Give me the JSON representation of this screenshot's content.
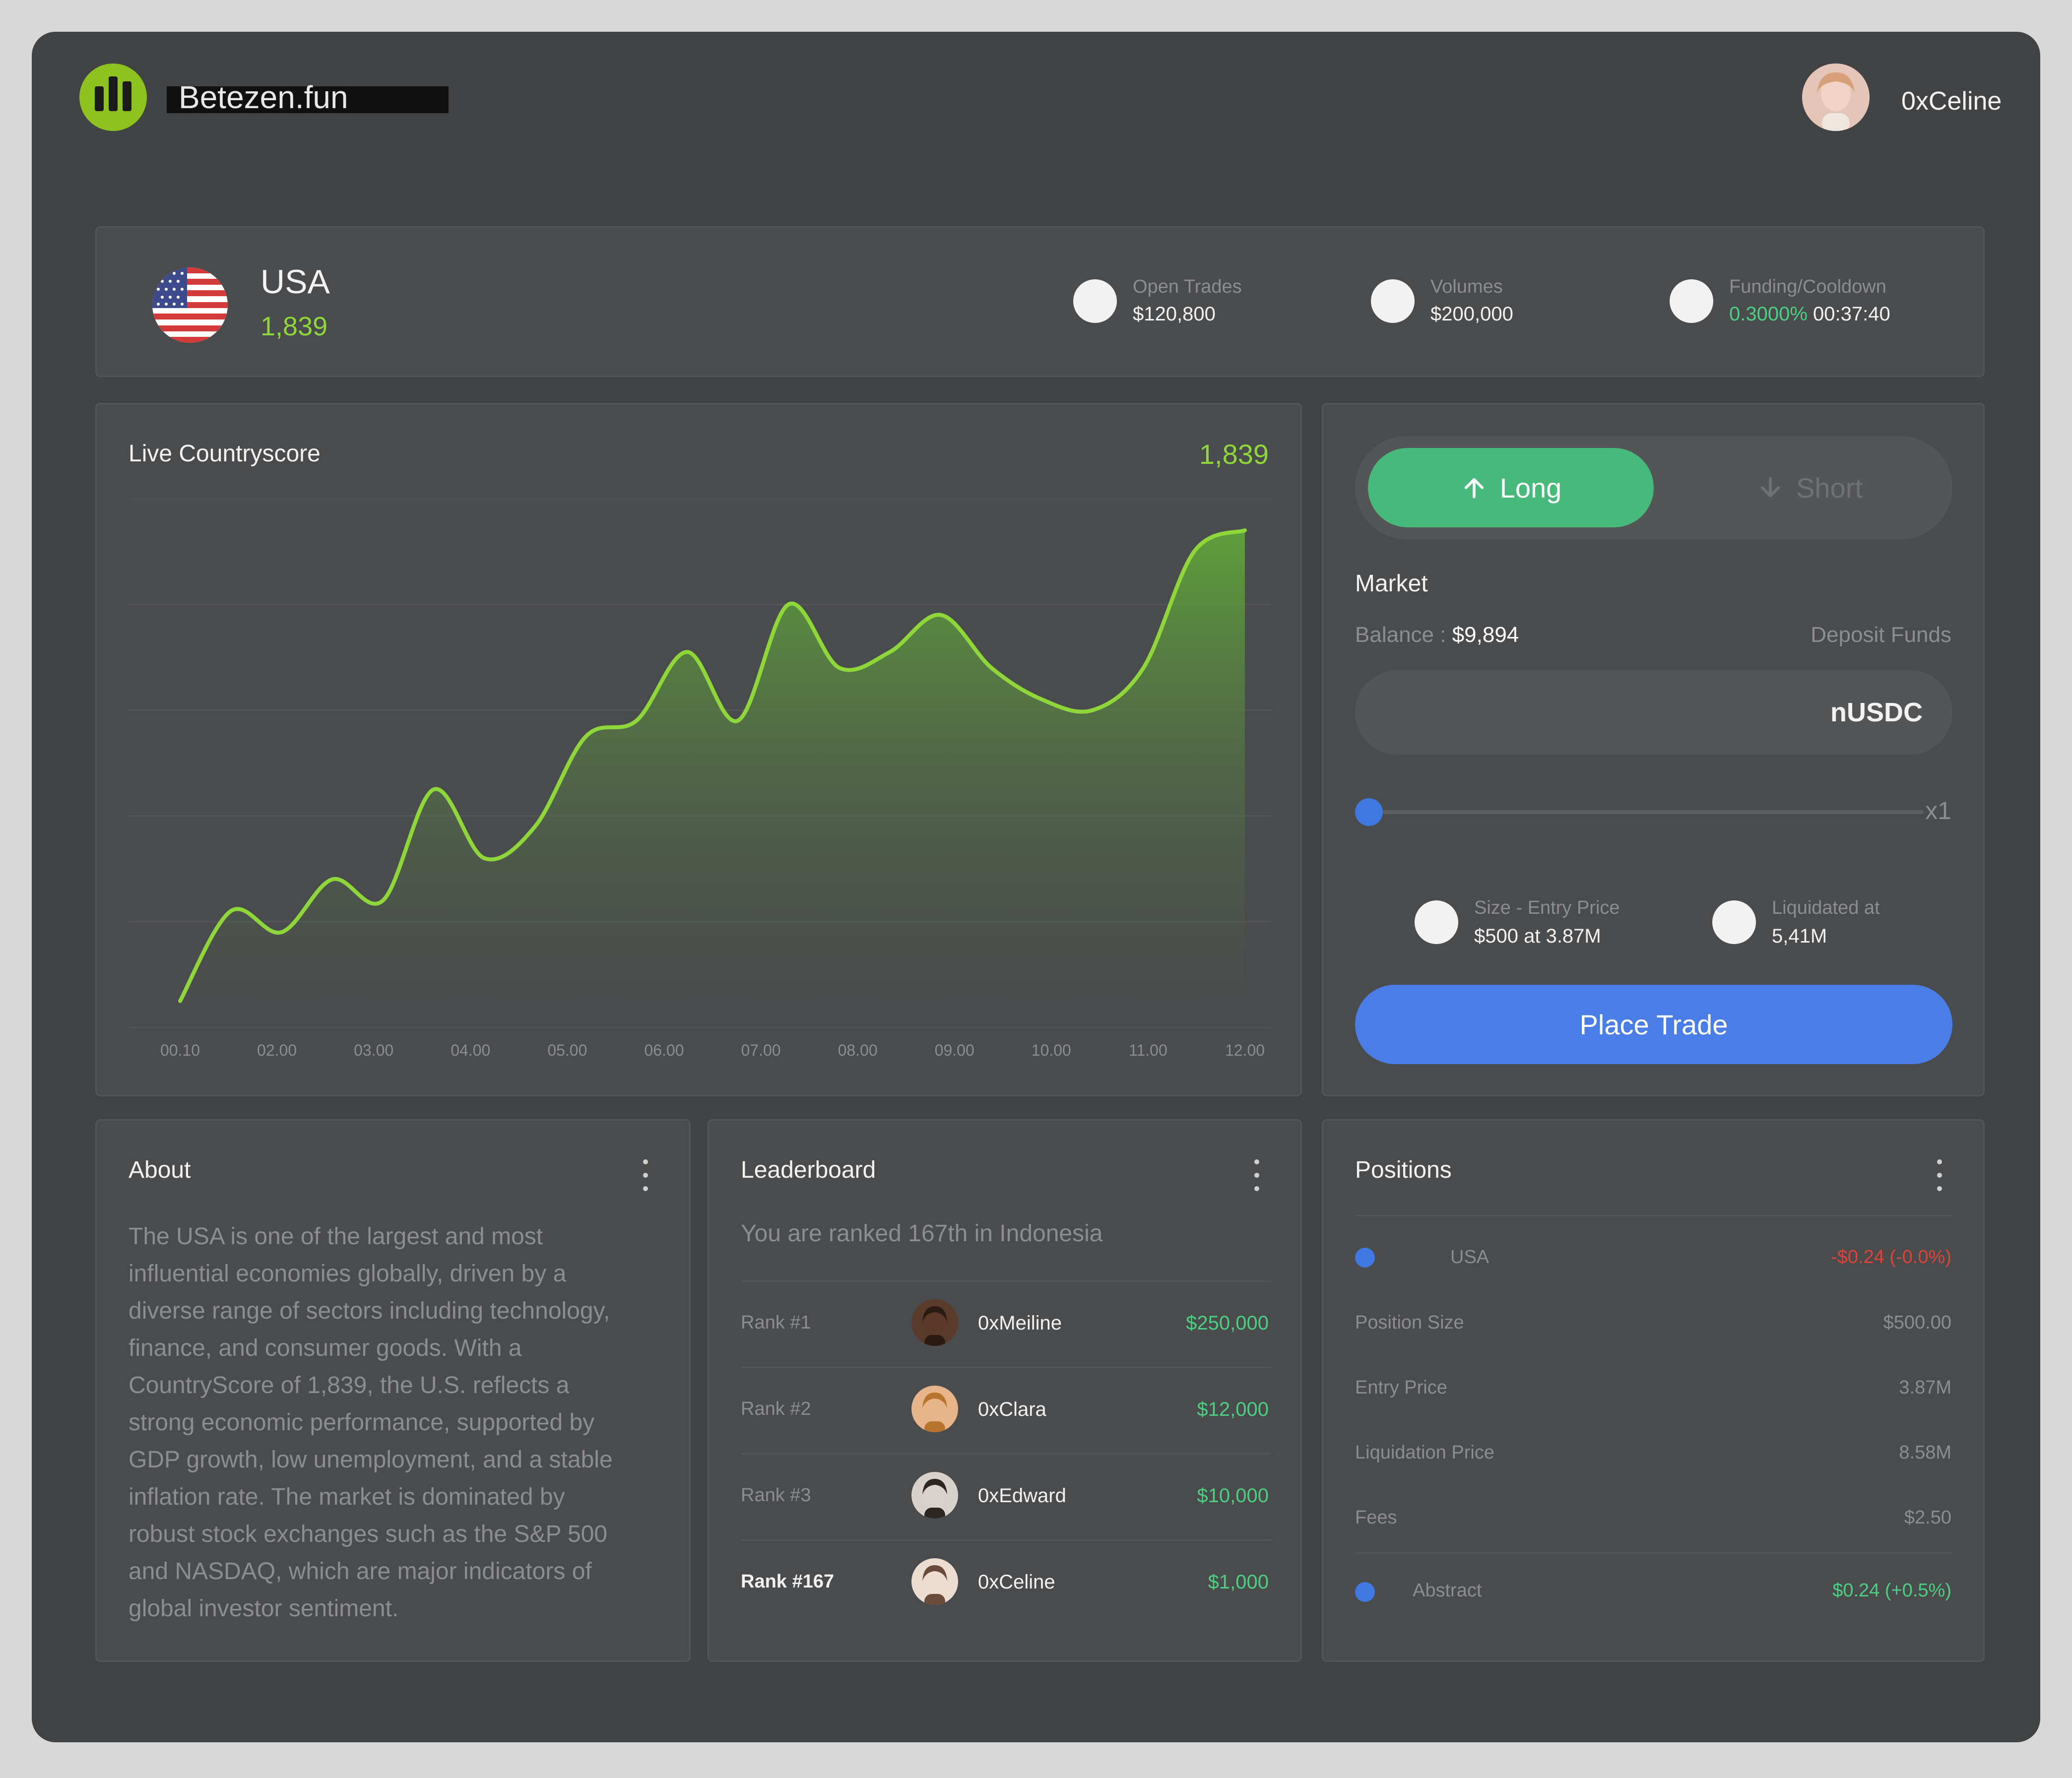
{
  "header": {
    "brand": "Betezen.fun",
    "username": "0xCeline"
  },
  "country": {
    "name": "USA",
    "score": "1,839",
    "stats": [
      {
        "label": "Open Trades",
        "value": "$120,800"
      },
      {
        "label": "Volumes",
        "value": "$200,000"
      },
      {
        "label": "Funding/Cooldown",
        "value_rate": "0.3000%",
        "value_time": "00:37:40"
      }
    ]
  },
  "chart_data": {
    "type": "area",
    "title": "Live Countryscore",
    "current_value": "1,839",
    "categories": [
      "00.10",
      "02.00",
      "03.00",
      "04.00",
      "05.00",
      "06.00",
      "07.00",
      "08.00",
      "09.00",
      "10.00",
      "11.00",
      "12.00"
    ],
    "gridlines": 6,
    "series": [
      {
        "values": [
          0.05,
          0.22,
          0.18,
          0.28,
          0.24,
          0.45,
          0.32,
          0.38,
          0.55,
          0.58,
          0.71,
          0.58,
          0.8,
          0.68,
          0.71,
          0.78,
          0.68,
          0.62,
          0.6,
          0.68,
          0.9,
          0.94
        ]
      }
    ],
    "colors": {
      "line": "#8ed63a",
      "fill_top": "#5fa33a",
      "fill_bottom": "#4a4b4d"
    }
  },
  "trade": {
    "long_label": "Long",
    "short_label": "Short",
    "market_label": "Market",
    "balance_label": "Balance : ",
    "balance_value": "$9,894",
    "deposit_label": "Deposit Funds",
    "currency": "nUSDC",
    "leverage": "x1",
    "leverage_fraction": 0,
    "size_label": "Size - Entry Price",
    "size_value": "$500 at 3.87M",
    "liq_label": "Liquidated at",
    "liq_value": "5,41M",
    "place_label": "Place Trade"
  },
  "about": {
    "title": "About",
    "lines": [
      "The USA is one of the largest and most",
      "influential economies globally, driven by a",
      "diverse range of sectors including technology,",
      "finance, and consumer goods. With a",
      "CountryScore of 1,839, the U.S. reflects a",
      "strong economic performance, supported by",
      "GDP growth, low unemployment, and a stable",
      "inflation rate. The market is dominated by",
      "robust stock exchanges such as the S&P 500",
      "and NASDAQ, which are major indicators of",
      "global investor sentiment."
    ]
  },
  "leaderboard": {
    "title": "Leaderboard",
    "subtitle": "You are ranked 167th in Indonesia",
    "rows": [
      {
        "rank": "Rank #1",
        "name": "0xMeiline",
        "amount": "$250,000"
      },
      {
        "rank": "Rank #2",
        "name": "0xClara",
        "amount": "$12,000"
      },
      {
        "rank": "Rank #3",
        "name": "0xEdward",
        "amount": "$10,000"
      },
      {
        "rank": "Rank #167",
        "name": "0xCeline",
        "amount": "$1,000"
      }
    ]
  },
  "positions": {
    "title": "Positions",
    "top": {
      "name": "USA",
      "pnl": "-$0.24 (-0.0%)"
    },
    "details": [
      {
        "label": "Position Size",
        "value": "$500.00"
      },
      {
        "label": "Entry Price",
        "value": "3.87M"
      },
      {
        "label": "Liquidation Price",
        "value": "8.58M"
      },
      {
        "label": "Fees",
        "value": "$2.50"
      }
    ],
    "bottom": {
      "name": "Abstract",
      "pnl": "$0.24 (+0.5%)"
    }
  }
}
